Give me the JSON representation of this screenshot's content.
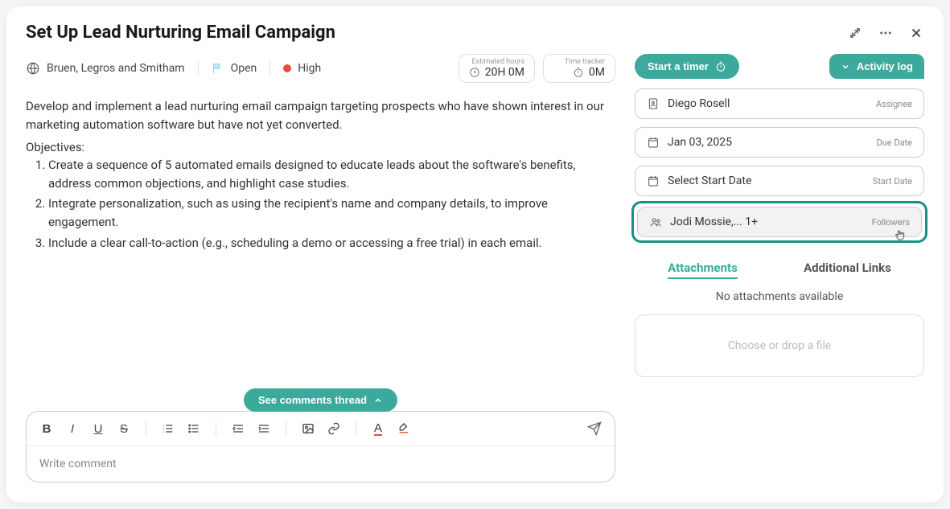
{
  "header": {
    "title": "Set Up Lead Nurturing Email Campaign"
  },
  "meta": {
    "company": "Bruen, Legros and Smitham",
    "status": "Open",
    "priority": "High",
    "estimated_label": "Estimated hours",
    "estimated_value": "20H 0M",
    "tracker_label": "Time tracker",
    "tracker_value": "0M"
  },
  "description": "Develop and implement a lead nurturing email campaign targeting prospects who have shown interest in our marketing automation software but have not yet converted.",
  "objectives_title": "Objectives:",
  "objectives": [
    "Create a sequence of 5 automated emails designed to educate leads about the software's benefits, address common objections, and highlight case studies.",
    "Integrate personalization, such as using the recipient's name and company details, to improve engagement.",
    "Include a clear call-to-action (e.g., scheduling a demo or accessing a free trial) in each email."
  ],
  "comments": {
    "see_thread": "See comments thread",
    "placeholder": "Write comment"
  },
  "right": {
    "start_timer": "Start a timer",
    "activity_log": "Activity log",
    "assignee": {
      "value": "Diego Rosell",
      "label": "Assignee"
    },
    "due_date": {
      "value": "Jan 03, 2025",
      "label": "Due Date"
    },
    "start_date": {
      "value": "Select Start Date",
      "label": "Start Date"
    },
    "followers": {
      "value": "Jodi Mossie,... 1+",
      "label": "Followers"
    },
    "tabs": {
      "attachments": "Attachments",
      "links": "Additional Links"
    },
    "no_attachments": "No attachments available",
    "dropzone": "Choose or drop a file"
  }
}
